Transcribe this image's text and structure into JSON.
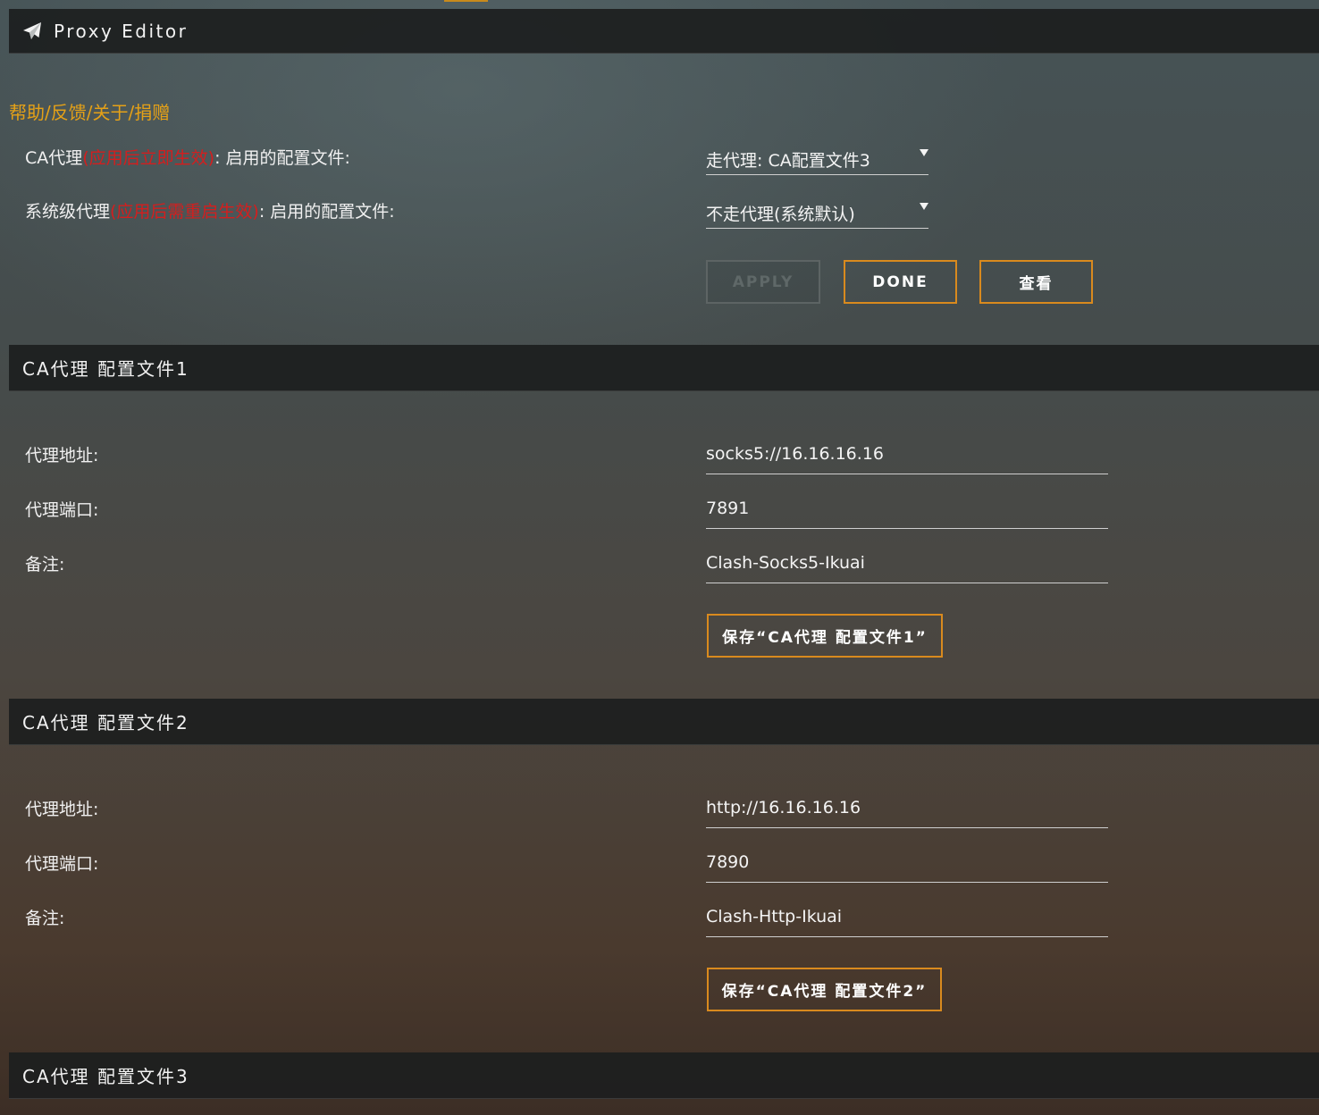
{
  "header": {
    "title": "Proxy Editor",
    "icon": "paper-plane-icon"
  },
  "help_link": "帮助/反馈/关于/捐赠",
  "global": {
    "ca_proxy": {
      "label_prefix": "CA代理",
      "label_warn": "(应用后立即生效)",
      "label_suffix": ": 启用的配置文件:",
      "selected": "走代理: CA配置文件3"
    },
    "system_proxy": {
      "label_prefix": "系统级代理",
      "label_warn": "(应用后需重启生效)",
      "label_suffix": ": 启用的配置文件:",
      "selected": "不走代理(系统默认)"
    },
    "buttons": {
      "apply": "APPLY",
      "done": "DONE",
      "view": "查看"
    }
  },
  "profiles": [
    {
      "title": "CA代理 配置文件1",
      "address_label": "代理地址:",
      "address": "socks5://16.16.16.16",
      "port_label": "代理端口:",
      "port": "7891",
      "note_label": "备注:",
      "note": "Clash-Socks5-Ikuai",
      "save_label": "保存“CA代理 配置文件1”"
    },
    {
      "title": "CA代理 配置文件2",
      "address_label": "代理地址:",
      "address": "http://16.16.16.16",
      "port_label": "代理端口:",
      "port": "7890",
      "note_label": "备注:",
      "note": "Clash-Http-Ikuai",
      "save_label": "保存“CA代理 配置文件2”"
    },
    {
      "title": "CA代理 配置文件3"
    }
  ],
  "colors": {
    "accent": "#d98a1e",
    "help_link": "#e5a117",
    "warning": "#d41e1e",
    "bar": "#1c1e1e"
  }
}
